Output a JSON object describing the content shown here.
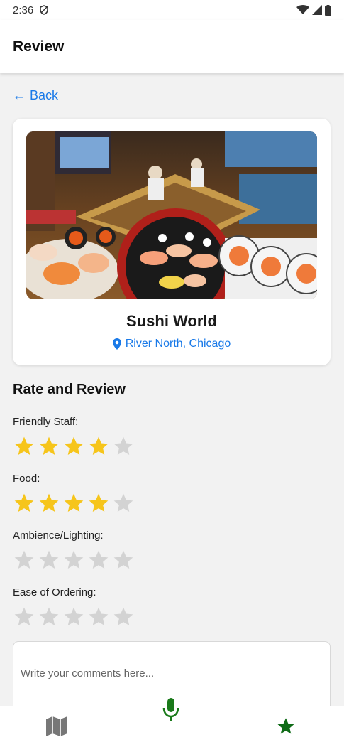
{
  "status": {
    "time": "2:36"
  },
  "header": {
    "title": "Review"
  },
  "back": {
    "label": "Back",
    "arrow": "←"
  },
  "restaurant": {
    "name": "Sushi World",
    "location": "River North, Chicago"
  },
  "review": {
    "title": "Rate and Review",
    "categories": [
      {
        "label": "Friendly Staff:",
        "rating": 4,
        "max": 5
      },
      {
        "label": "Food:",
        "rating": 4,
        "max": 5
      },
      {
        "label": "Ambience/Lighting:",
        "rating": 0,
        "max": 5
      },
      {
        "label": "Ease of Ordering:",
        "rating": 0,
        "max": 5
      }
    ],
    "comment_placeholder": "Write your comments here..."
  },
  "nav": [
    {
      "icon": "map-icon",
      "color": "#777777"
    },
    {
      "icon": "microphone-icon",
      "color": "#1a7a1a"
    },
    {
      "icon": "star-icon",
      "color": "#0f6b17"
    }
  ],
  "colors": {
    "accent": "#1a7ae8",
    "star_filled": "#f6c51b",
    "star_empty": "#d3d3d3"
  }
}
